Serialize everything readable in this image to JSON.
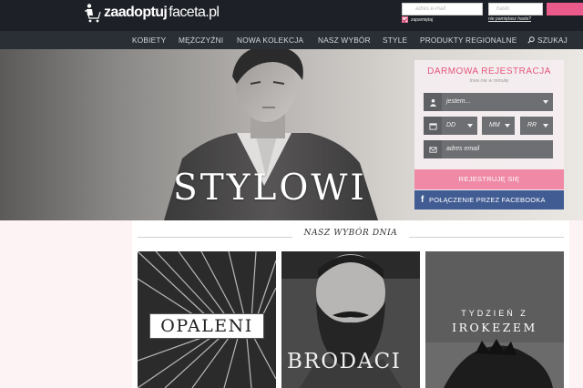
{
  "header": {
    "logo": {
      "part1": "zaadoptuj",
      "part2": "faceta.pl"
    },
    "login": {
      "email_placeholder": "adres e-mail",
      "password_placeholder": "hasło",
      "remember_label": "zapamiętaj",
      "forgot_link": "nie pamiętasz hasła?"
    }
  },
  "nav": {
    "items": [
      "KOBIETY",
      "MĘŻCZYŹNI",
      "NOWA KOLEKCJA",
      "NASZ WYBÓR",
      "STYLE",
      "PRODUKTY REGIONALNE"
    ],
    "search_label": "SZUKAJ"
  },
  "hero": {
    "title": "STYLOWI"
  },
  "registration": {
    "title": "DARMOWA REJESTRACJA",
    "subtitle": "trwa nie w minutę",
    "gender_placeholder": "jestem...",
    "day_placeholder": "DD",
    "month_placeholder": "MM",
    "year_placeholder": "RR",
    "email_placeholder": "adres email",
    "submit_label": "REJESTRUJĘ SIĘ",
    "facebook_label": "POŁĄCZENIE PRZEZ FACEBOOKA"
  },
  "picks": {
    "title": "NASZ WYBÓR DNIA",
    "tiles": [
      {
        "label": "OPALENI"
      },
      {
        "label": "BRODACI"
      },
      {
        "label_line1": "TYDZIEŃ Z",
        "label_line2": "IROKEZEM"
      }
    ]
  },
  "colors": {
    "accent_pink": "#e4577e",
    "facebook_blue": "#405c92",
    "topbar": "#1d2127",
    "nav": "#2a2f36"
  },
  "icons": [
    "user-icon",
    "calendar-icon",
    "mail-icon",
    "search-icon",
    "facebook-icon",
    "shopping-cart-icon",
    "checkbox-icon"
  ]
}
